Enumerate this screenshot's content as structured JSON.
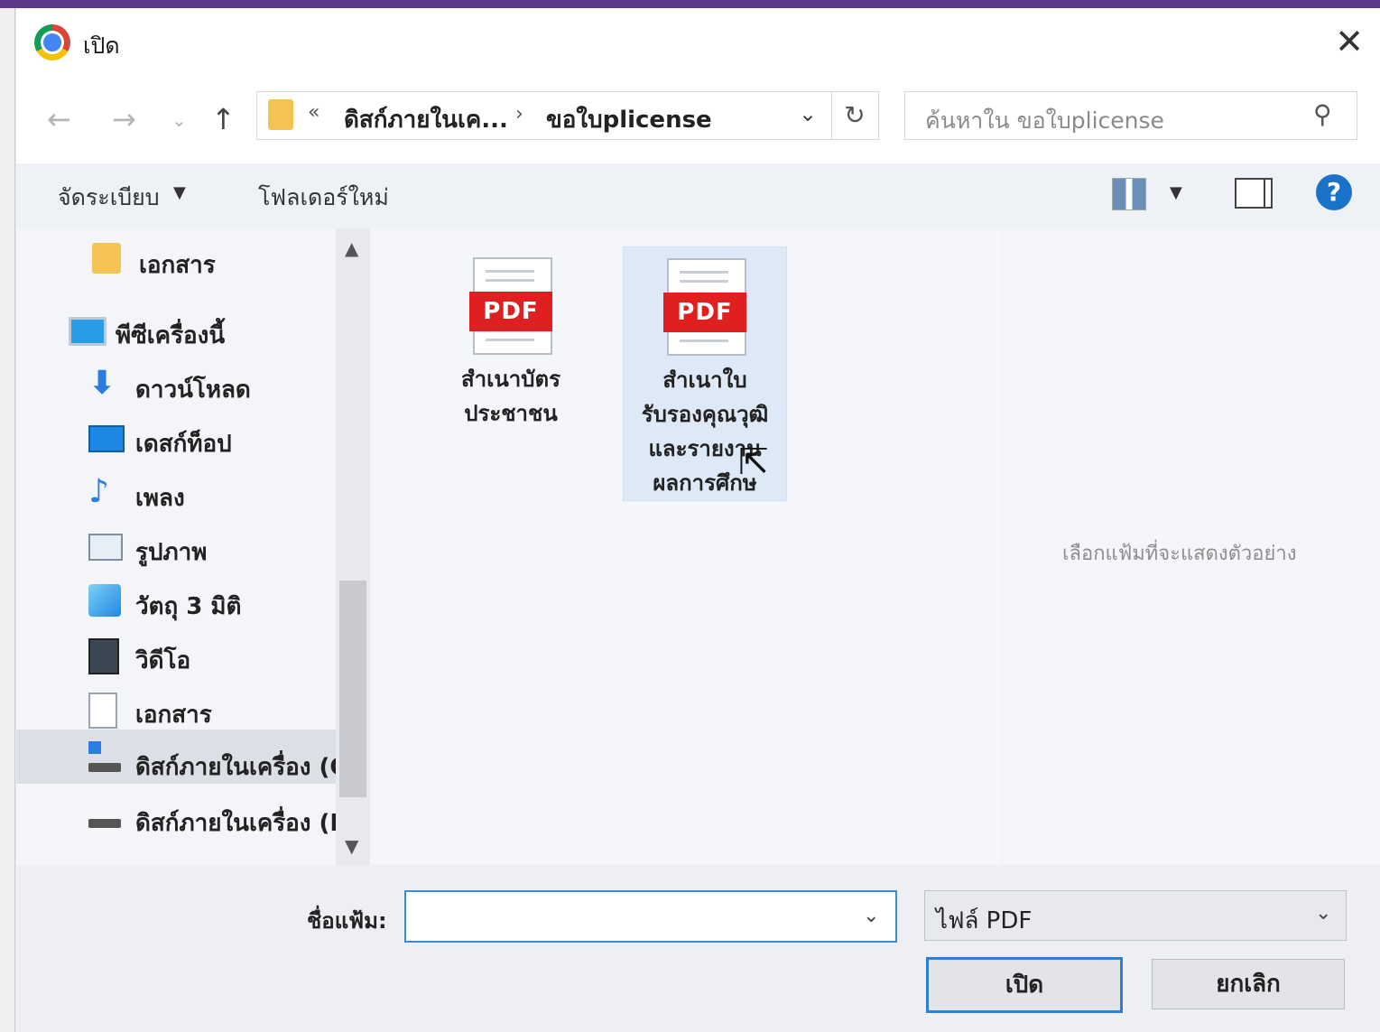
{
  "window": {
    "title": "เปิด"
  },
  "nav": {
    "breadcrumb": [
      "ดิสก์ภายในเค...",
      "ขอใบplicense"
    ],
    "overflow_marker": "«",
    "separator": "›"
  },
  "search": {
    "placeholder": "ค้นหาใน ขอใบplicense"
  },
  "toolbar": {
    "organize_label": "จัดระเบียบ",
    "new_folder_label": "โฟลเดอร์ใหม่",
    "help_label": "?"
  },
  "sidebar": {
    "items": [
      {
        "label": "เอกสาร",
        "icon": "folder-icon"
      },
      {
        "label": "พีซีเครื่องนี้",
        "icon": "computer-icon"
      },
      {
        "label": "ดาวน์โหลด",
        "icon": "download-icon"
      },
      {
        "label": "เดสก์ท็อป",
        "icon": "desktop-icon"
      },
      {
        "label": "เพลง",
        "icon": "music-icon"
      },
      {
        "label": "รูปภาพ",
        "icon": "pictures-icon"
      },
      {
        "label": "วัตถุ 3 มิติ",
        "icon": "3d-objects-icon"
      },
      {
        "label": "วิดีโอ",
        "icon": "video-icon"
      },
      {
        "label": "เอกสาร",
        "icon": "documents-icon"
      },
      {
        "label": "ดิสก์ภายในเครื่อง (C",
        "icon": "drive-c-icon",
        "selected": true
      },
      {
        "label": "ดิสก์ภายในเครื่อง (D",
        "icon": "drive-d-icon"
      }
    ]
  },
  "files": [
    {
      "name_line1": "สำเนาบัตร",
      "name_line2": "ประชาชน",
      "name_line3": "",
      "name_line4": "",
      "badge": "PDF",
      "selected": false
    },
    {
      "name_line1": "สำเนาใบ",
      "name_line2": "รับรองคุณวุฒิ",
      "name_line3": "และรายงาน",
      "name_line4": "ผลการศึกษ",
      "badge": "PDF",
      "selected": true
    }
  ],
  "preview": {
    "message": "เลือกแฟ้มที่จะแสดงตัวอย่าง"
  },
  "footer": {
    "filename_label": "ชื่อแฟ้ม:",
    "filename_value": "",
    "filetype_value": "ไฟล์ PDF",
    "open_label": "เปิด",
    "cancel_label": "ยกเลิก"
  },
  "colors": {
    "accent": "#2f7fd0",
    "pdf_red": "#e02020",
    "folder": "#f3c453",
    "selection": "#dde9f6"
  }
}
